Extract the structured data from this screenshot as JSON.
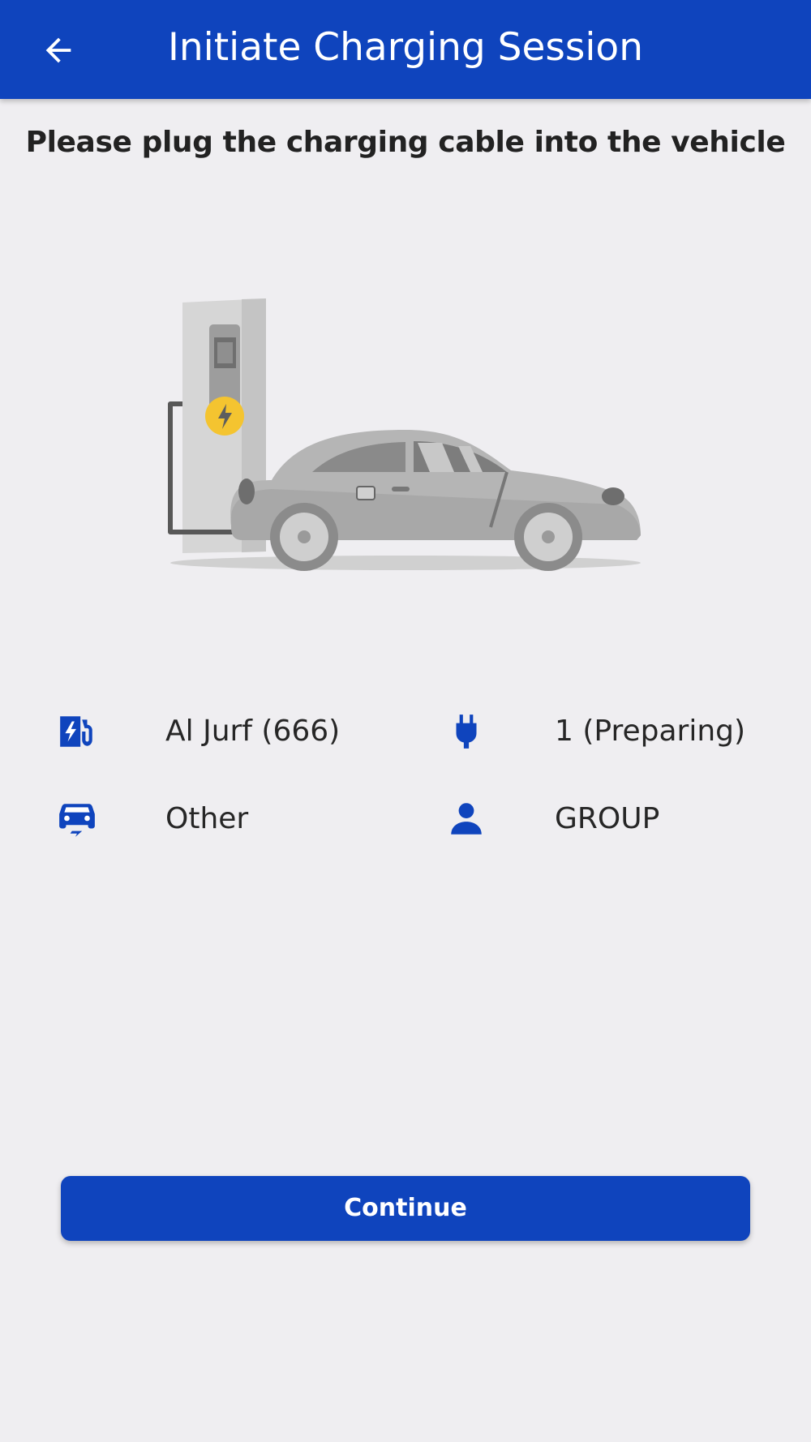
{
  "header": {
    "title": "Initiate Charging Session",
    "back_icon": "arrow-back-icon"
  },
  "instruction": "Please plug the charging cable into the vehicle",
  "illustration": "ev-charging-station-car",
  "info": {
    "station": {
      "icon": "ev-station-icon",
      "value": "Al Jurf (666)"
    },
    "connector": {
      "icon": "plug-icon",
      "value": "1 (Preparing)"
    },
    "vehicle": {
      "icon": "electric-car-icon",
      "value": "Other"
    },
    "user": {
      "icon": "person-icon",
      "value": "GROUP"
    }
  },
  "actions": {
    "continue_label": "Continue"
  },
  "colors": {
    "primary": "#0f44bd",
    "background": "#efeef1",
    "text": "#262626",
    "bolt_yellow": "#f4c430"
  }
}
